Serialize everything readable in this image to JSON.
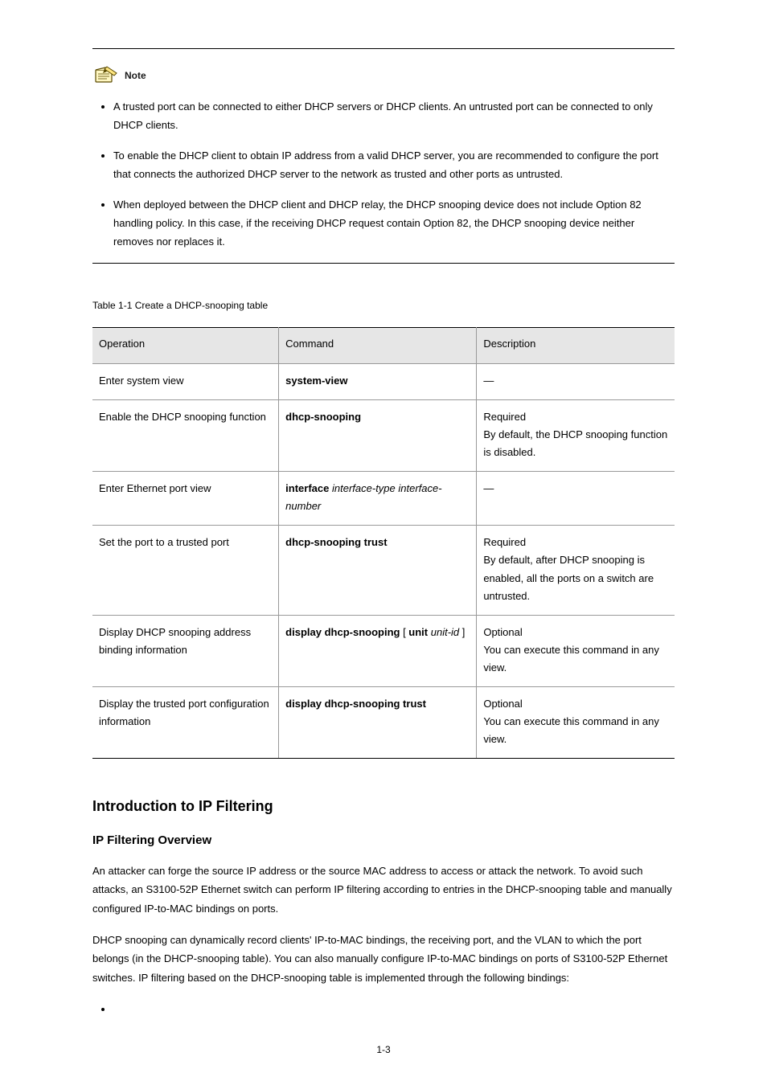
{
  "note": {
    "label": "Note",
    "items": [
      "A trusted port can be connected to either DHCP servers or DHCP clients. An untrusted port can be connected to only DHCP clients.",
      "To enable the DHCP client to obtain IP address from a valid DHCP server, you are recommended to configure the port that connects the authorized DHCP server to the network as trusted and other ports as untrusted.",
      "When deployed between the DHCP client and DHCP relay, the DHCP snooping device does not include Option 82 handling policy. In this case, if the receiving DHCP request contain Option 82, the DHCP snooping device neither removes nor replaces it."
    ]
  },
  "section": {
    "title": "Introduction to IP Filtering",
    "sub_title": "IP Filtering Overview",
    "para1": "An attacker can forge the source IP address or the source MAC address to access or attack the network. To avoid such attacks, an S3100-52P Ethernet switch can perform IP filtering according to entries in the DHCP-snooping table and manually configured IP-to-MAC bindings on ports.",
    "para2_prefix": "DHCP snooping can dynamically record clients' IP-to-MAC bindings, the receiving port, and the VLAN to which the port belongs (in the ",
    "para2_link": "DHCP-snooping table",
    "para2_suffix": "). You can also manually configure IP-to-MAC bindings on ports of S3100-52P Ethernet switches. IP filtering based on the DHCP-snooping table is implemented through the following bindings:"
  },
  "table": {
    "caption": "Table 1-1 Create a DHCP-snooping table",
    "headers": [
      "Operation",
      "Command",
      "Description"
    ],
    "rows": [
      {
        "op": "Enter system view",
        "cmd_html": "<span class=\"cmd-strong\">system-view</span>",
        "desc": "—"
      },
      {
        "op": "Enable the DHCP snooping function",
        "cmd_html": "<span class=\"cmd-strong\">dhcp-snooping</span>",
        "desc": "Required<br>By default, the DHCP snooping function is disabled."
      },
      {
        "op": "Enter Ethernet port view",
        "cmd_html": "<span class=\"cmd-strong\">interface</span> <span class=\"cmd-ital\">interface-type interface-number</span>",
        "desc": "—"
      },
      {
        "op": "Set the port to a trusted port",
        "cmd_html": "<span class=\"cmd-strong\">dhcp-snooping trust</span>",
        "desc": "Required<br>By default, after DHCP snooping is enabled, all the ports on a switch are untrusted."
      },
      {
        "op": "Display DHCP snooping address binding information",
        "cmd_html": "<span class=\"cmd-strong\">display dhcp-snooping</span> [ <span class=\"cmd-strong\">unit</span> <span class=\"cmd-ital\">unit-id</span> ]",
        "desc": "Optional<br>You can execute this command in any view."
      },
      {
        "op": "Display the trusted port configuration information",
        "cmd_html": "<span class=\"cmd-strong\">display dhcp-snooping trust</span>",
        "desc": "Optional<br>You can execute this command in any view."
      }
    ]
  },
  "page_number": "1-3"
}
